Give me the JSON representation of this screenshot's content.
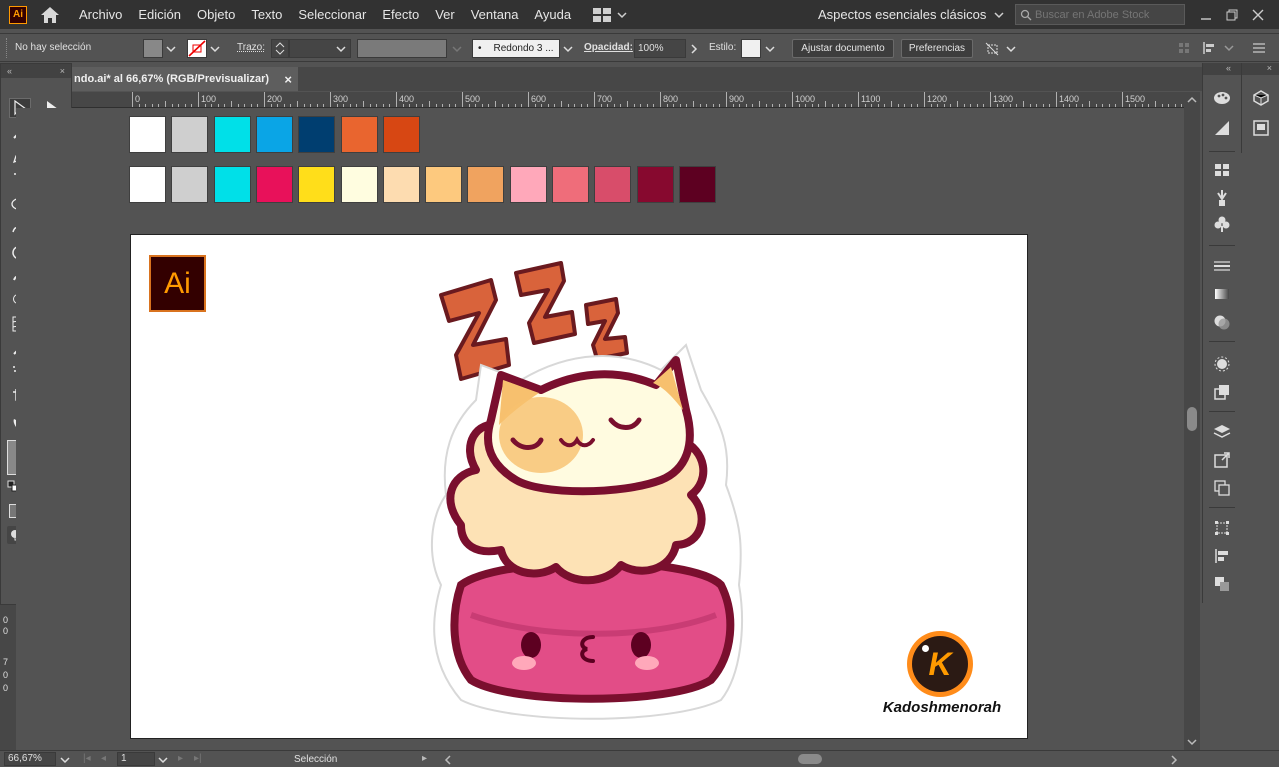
{
  "app": {
    "logo": "Ai",
    "home_icon": "home-icon"
  },
  "menu": [
    "Archivo",
    "Edición",
    "Objeto",
    "Texto",
    "Seleccionar",
    "Efecto",
    "Ver",
    "Ventana",
    "Ayuda"
  ],
  "workspace": {
    "label": "Aspectos esenciales clásicos"
  },
  "stock_search": {
    "placeholder": "Buscar en Adobe Stock"
  },
  "control": {
    "selection": "No hay selección",
    "stroke_label": "Trazo:",
    "brush": "Redondo 3 ...",
    "opacity_label": "Opacidad:",
    "opacity_value": "100%",
    "style_label": "Estilo:",
    "fit_button": "Ajustar documento",
    "prefs_button": "Preferencias"
  },
  "document": {
    "tab_title": "ndo.ai* al 66,67% (RGB/Previsualizar)",
    "close": "×"
  },
  "ruler": {
    "h_ticks": [
      "0",
      "100",
      "200",
      "300",
      "400",
      "500",
      "600",
      "700",
      "800",
      "900",
      "1000",
      "1100",
      "1200",
      "1300",
      "1400",
      "1500"
    ],
    "v_ticks": [
      "0",
      "0",
      "7",
      "0",
      "0"
    ]
  },
  "swatches": {
    "row1": [
      "#ffffff",
      "#cfcfcf",
      "#00e0e8",
      "#0aa5e6",
      "#003e70",
      "#e9652f",
      "#d74713"
    ],
    "row2": [
      "#ffffff",
      "#cfcfcf",
      "#00e0e8",
      "#e8115a",
      "#ffde1a",
      "#fffde0",
      "#fddcb0",
      "#fdc97e",
      "#f0a35f",
      "#ffa8ba",
      "#ef6d7a",
      "#d84d6a",
      "#87092f",
      "#5d0021"
    ]
  },
  "artwork": {
    "ai_badge": "Ai",
    "zzz": "ZZZ",
    "brand_initial": "K",
    "brand_name": "Kadoshmenorah"
  },
  "status": {
    "zoom": "66,67%",
    "page": "1",
    "tool": "Selección"
  },
  "colors": {
    "accent_orange": "#ff9a00",
    "cat_outline": "#7a0f2e",
    "bed_pink": "#e24d87",
    "zzz_orange": "#d9633b"
  }
}
